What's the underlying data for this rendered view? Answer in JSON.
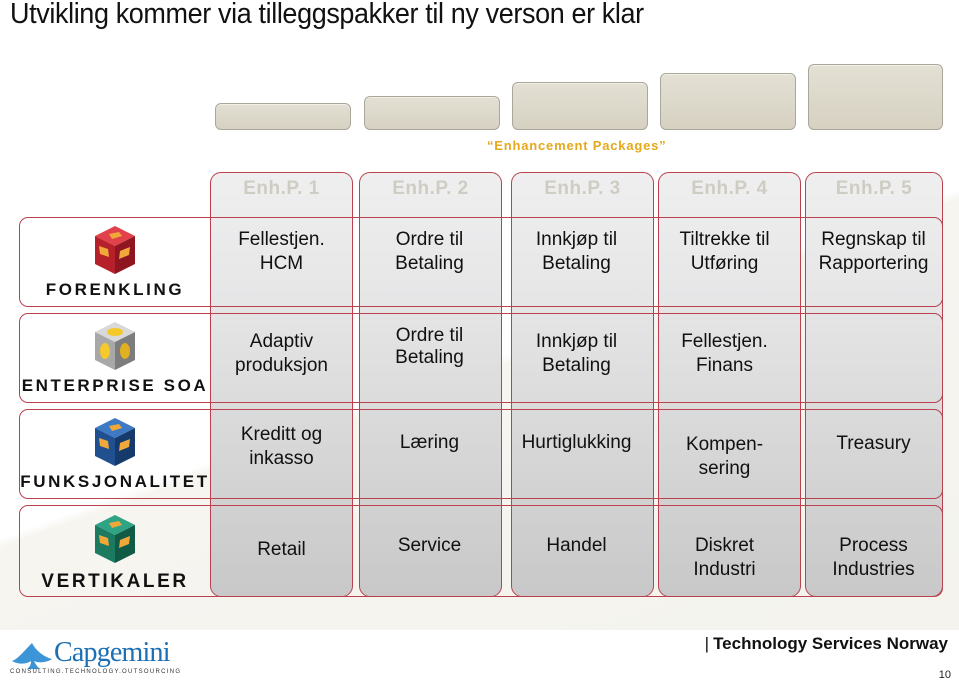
{
  "title": "Utvikling kommer via tilleggspakker til ny verson er klar",
  "enhancement_label": "“Enhancement Packages”",
  "colors": {
    "accent_border": "#b8434f",
    "enhancement_label": "#e6a81c",
    "column_header_text": "#cfcdc3",
    "step_fill": "#d9d5c6",
    "logo_blue": "#1a6fb5"
  },
  "columns": [
    {
      "label": "Enh.P. 1"
    },
    {
      "label": "Enh.P. 2"
    },
    {
      "label": "Enh.P. 3"
    },
    {
      "label": "Enh.P. 4"
    },
    {
      "label": "Enh.P. 5"
    }
  ],
  "rows": [
    {
      "label": "FORENKLING",
      "icon": "red-cube-icon",
      "cells": [
        [
          "Fellestjen.",
          "HCM"
        ],
        [
          "Ordre til",
          "Betaling"
        ],
        [
          "Innkjøp til",
          "Betaling"
        ],
        [
          "Tiltrekke til",
          "Utføring"
        ],
        [
          "Regnskap til",
          "Rapportering"
        ]
      ]
    },
    {
      "label": "ENTERPRISE SOA",
      "icon": "silver-cube-icon",
      "cells": [
        [
          "Adaptiv",
          "produksjon"
        ],
        [
          "Ordre til",
          "Betaling"
        ],
        [
          "Innkjøp til",
          "Betaling"
        ],
        [
          "Fellestjen.",
          "Finans"
        ],
        [
          "",
          ""
        ]
      ]
    },
    {
      "label": "FUNKSJONALITET",
      "icon": "blue-cube-icon",
      "cells": [
        [
          "Kreditt og",
          "inkasso"
        ],
        [
          "Læring",
          ""
        ],
        [
          "Hurtiglukking",
          ""
        ],
        [
          "Kompen-",
          "sering"
        ],
        [
          "Treasury",
          ""
        ]
      ]
    },
    {
      "label": "VERTIKALER",
      "icon": "green-cube-icon",
      "cells": [
        [
          "Retail",
          ""
        ],
        [
          "Service",
          ""
        ],
        [
          "Handel",
          ""
        ],
        [
          "Diskret",
          "Industri"
        ],
        [
          "Process",
          "Industries"
        ]
      ]
    }
  ],
  "footer": {
    "logo_word": "Capgemini",
    "logo_tagline": "CONSULTING.TECHNOLOGY.OUTSOURCING",
    "separator": "|",
    "company": "Technology Services Norway",
    "page_number": "10"
  }
}
